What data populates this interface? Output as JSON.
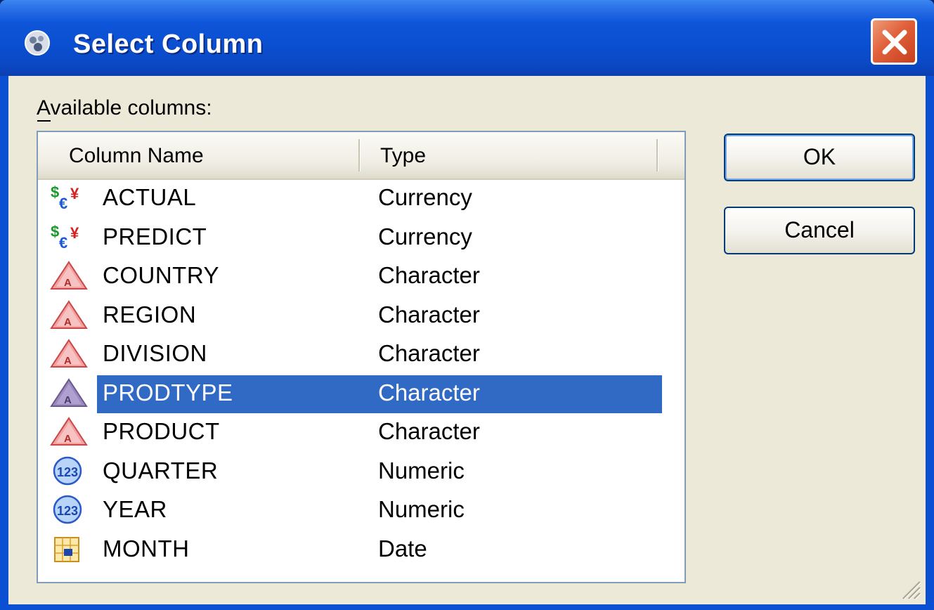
{
  "window": {
    "title": "Select Column",
    "title_icon": "sas-app-icon",
    "close_icon": "close-x-icon"
  },
  "list": {
    "label": "Available columns:",
    "headers": {
      "name": "Column Name",
      "type": "Type"
    },
    "rows": [
      {
        "name": "ACTUAL",
        "type": "Currency",
        "icon": "currency-icon"
      },
      {
        "name": "PREDICT",
        "type": "Currency",
        "icon": "currency-icon"
      },
      {
        "name": "COUNTRY",
        "type": "Character",
        "icon": "character-icon"
      },
      {
        "name": "REGION",
        "type": "Character",
        "icon": "character-icon"
      },
      {
        "name": "DIVISION",
        "type": "Character",
        "icon": "character-icon"
      },
      {
        "name": "PRODTYPE",
        "type": "Character",
        "icon": "character-icon",
        "selected": true
      },
      {
        "name": "PRODUCT",
        "type": "Character",
        "icon": "character-icon"
      },
      {
        "name": "QUARTER",
        "type": "Numeric",
        "icon": "numeric-icon"
      },
      {
        "name": "YEAR",
        "type": "Numeric",
        "icon": "numeric-icon"
      },
      {
        "name": "MONTH",
        "type": "Date",
        "icon": "date-icon"
      }
    ]
  },
  "buttons": {
    "ok": "OK",
    "cancel": "Cancel"
  },
  "colors": {
    "titlebar": "#0b4fd2",
    "selection": "#316ac5",
    "dialog_bg": "#ece9d8"
  }
}
